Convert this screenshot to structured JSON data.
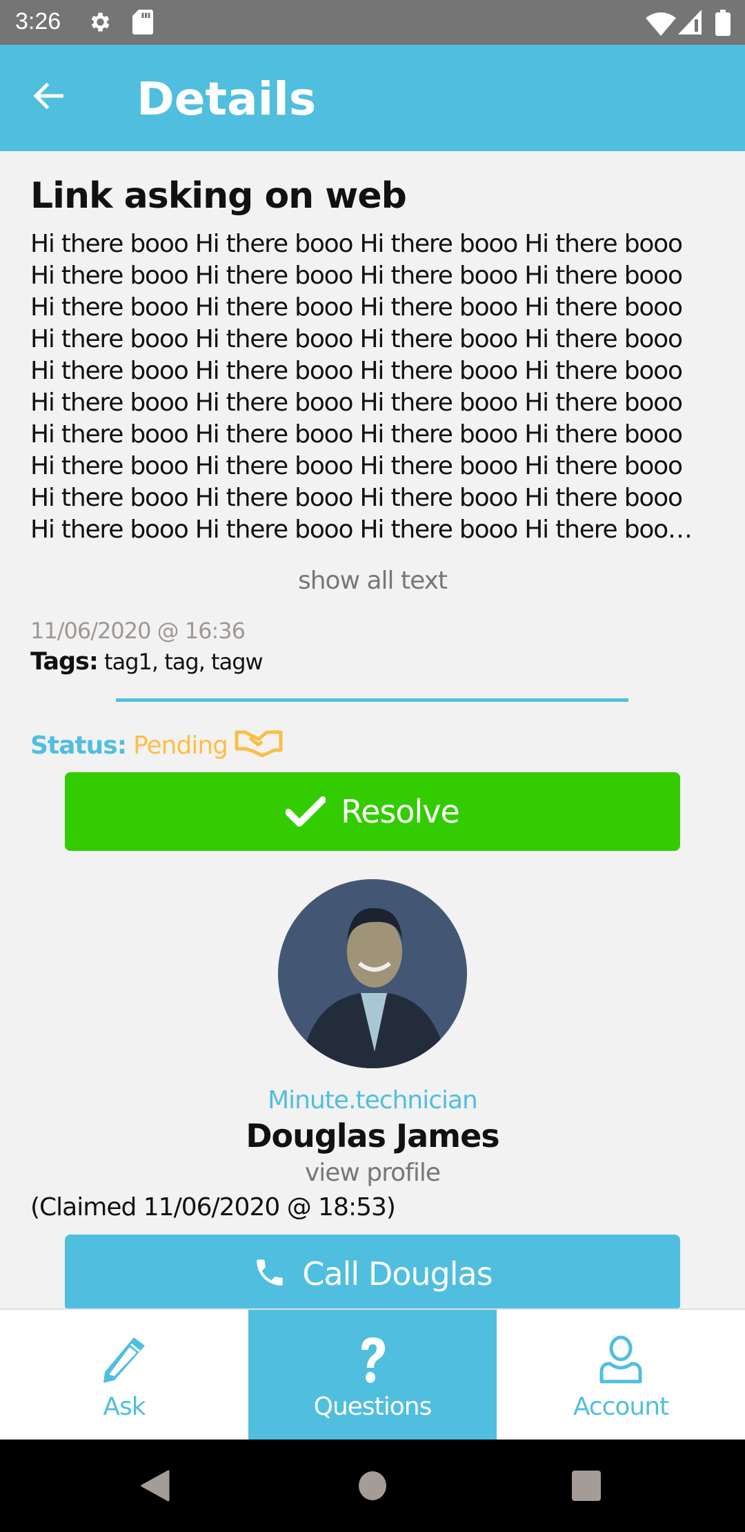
{
  "status_bar": {
    "time": "3:26",
    "left_icons": [
      "gear-icon",
      "sd-card-icon"
    ],
    "right_icons": [
      "wifi-icon",
      "signal-icon",
      "battery-icon"
    ]
  },
  "app_bar": {
    "back_icon": "arrow-left-icon",
    "title": "Details"
  },
  "question": {
    "title": "Link asking on web",
    "body_lines": [
      "Hi there booo Hi there booo Hi there booo Hi there booo",
      "Hi there booo Hi there booo Hi there booo Hi there booo",
      "Hi there booo Hi there booo Hi there booo Hi there booo",
      "Hi there booo Hi there booo Hi there booo Hi there booo",
      "Hi there booo Hi there booo Hi there booo Hi there booo",
      "Hi there booo Hi there booo Hi there booo Hi there booo",
      "Hi there booo Hi there booo Hi there booo Hi there booo",
      "Hi there booo Hi there booo Hi there booo Hi there booo",
      "Hi there booo Hi there booo Hi there booo Hi there booo",
      "Hi there booo Hi there booo Hi there booo Hi there boo…"
    ],
    "show_all_label": "show all text",
    "date": "11/06/2020 @ 16:36",
    "tags_label": "Tags:",
    "tags": "tag1, tag, tagw"
  },
  "status": {
    "label": "Status:",
    "value": "Pending",
    "icon": "handshake-icon",
    "colors": {
      "label": "#50bedf",
      "value": "#fbbf45"
    }
  },
  "resolve_button": {
    "label": "Resolve",
    "icon": "check-icon",
    "color": "#33cc00"
  },
  "technician": {
    "role": "Minute.technician",
    "name": "Douglas James",
    "view_profile_label": "view profile",
    "claimed": "(Claimed 11/06/2020 @ 18:53)"
  },
  "call_button": {
    "label": "Call Douglas",
    "icon": "phone-icon",
    "color": "#50bedf"
  },
  "bottom_nav": {
    "items": [
      {
        "label": "Ask",
        "icon": "pencil-icon",
        "active": false
      },
      {
        "label": "Questions",
        "icon": "question-icon",
        "active": true
      },
      {
        "label": "Account",
        "icon": "user-icon",
        "active": false
      }
    ]
  },
  "system_nav": [
    "back-triangle-icon",
    "home-circle-icon",
    "recents-square-icon"
  ],
  "theme": {
    "accent": "#50bedf",
    "background": "#f2f2f2"
  }
}
